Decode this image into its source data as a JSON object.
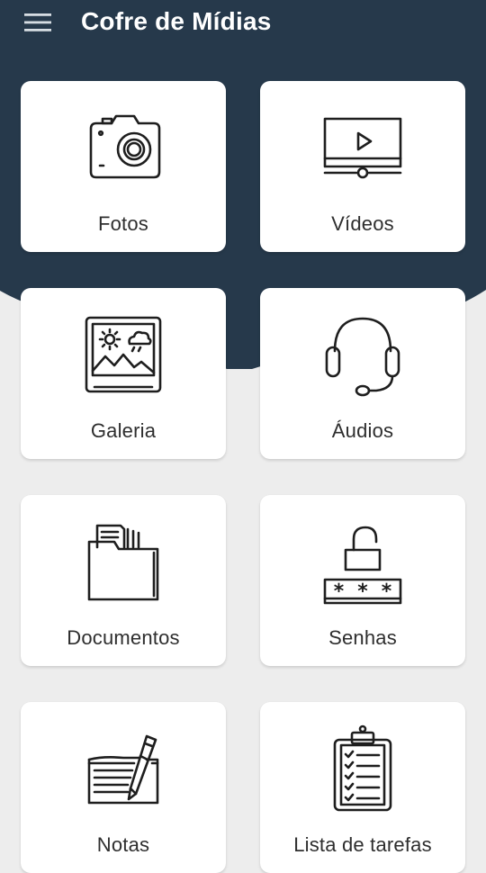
{
  "app_bar": {
    "title": "Cofre de Mídias",
    "menu_icon": "hamburger-menu-icon"
  },
  "colors": {
    "header_background": "#26394b",
    "page_background": "#ededed",
    "tile_background": "#ffffff",
    "icon_stroke": "#1e1e1e",
    "label_text": "#2e2e2e",
    "title_text": "#ffffff"
  },
  "tiles": [
    {
      "label": "Fotos",
      "icon": "camera-icon"
    },
    {
      "label": "Vídeos",
      "icon": "video-player-icon"
    },
    {
      "label": "Galeria",
      "icon": "picture-frame-icon"
    },
    {
      "label": "Áudios",
      "icon": "headset-icon"
    },
    {
      "label": "Documentos",
      "icon": "folder-documents-icon"
    },
    {
      "label": "Senhas",
      "icon": "padlock-password-icon"
    },
    {
      "label": "Notas",
      "icon": "notepad-pen-icon"
    },
    {
      "label": "Lista de tarefas",
      "icon": "clipboard-checklist-icon"
    }
  ]
}
